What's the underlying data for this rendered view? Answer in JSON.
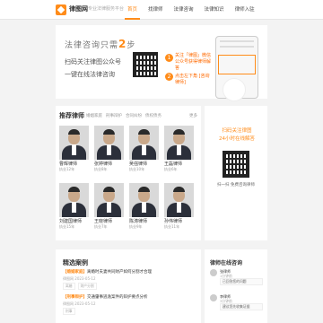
{
  "header": {
    "brand": "律图网",
    "brand_sub": "专业法律服务平台",
    "nav": [
      {
        "label": "首页",
        "active": true
      },
      {
        "label": "找律师",
        "active": false
      },
      {
        "label": "法律咨询",
        "active": false
      },
      {
        "label": "法律知识",
        "active": false
      },
      {
        "label": "律师入驻",
        "active": false
      }
    ]
  },
  "banner": {
    "title_prefix": "法律咨询只需",
    "title_num": "2",
    "title_suffix": "步",
    "line1": "扫码关注律图公众号",
    "line2": "一键在线法律咨询",
    "step1_num": "1",
    "step1_text": "关注「律图」微信公众号获得律师解答",
    "step2_num": "2",
    "step2_text": "点击左下角 [咨询律师]"
  },
  "lawyers": {
    "title": "推荐律师",
    "tabs": [
      "婚姻家庭",
      "刑事辩护",
      "合同纠纷",
      "债权债务"
    ],
    "more": "更多",
    "items": [
      {
        "name": "曹辉律师",
        "sub": "执业12年"
      },
      {
        "name": "张婷律师",
        "sub": "执业8年"
      },
      {
        "name": "吴强律师",
        "sub": "执业10年"
      },
      {
        "name": "王磊律师",
        "sub": "执业6年"
      },
      {
        "name": "刘建国律师",
        "sub": "执业15年"
      },
      {
        "name": "王晓律师",
        "sub": "执业7年"
      },
      {
        "name": "陈涛律师",
        "sub": "执业9年"
      },
      {
        "name": "孙伟律师",
        "sub": "执业11年"
      }
    ]
  },
  "side": {
    "text1": "扫码关注律图",
    "text2": "24小时在线解答",
    "label": "扫一扫 免费咨询律师"
  },
  "cases": {
    "title": "精选案例",
    "items": [
      {
        "label": "【婚姻家庭】",
        "text": "离婚时夫妻共同财产如何分割才合理"
      },
      {
        "label": "【刑事辩护】",
        "text": "交通肇事逃逸案件的辩护要点分析"
      }
    ],
    "meta": "律图网 2023-05-12",
    "tags": [
      "离婚",
      "财产分割",
      "刑事"
    ]
  },
  "consult": {
    "title": "律师在线咨询",
    "items": [
      {
        "name": "张律师",
        "time": "1分钟前",
        "text": "已回答您的问题"
      },
      {
        "name": "李律师",
        "time": "3分钟前",
        "text": "建议您先收集证据"
      }
    ]
  }
}
